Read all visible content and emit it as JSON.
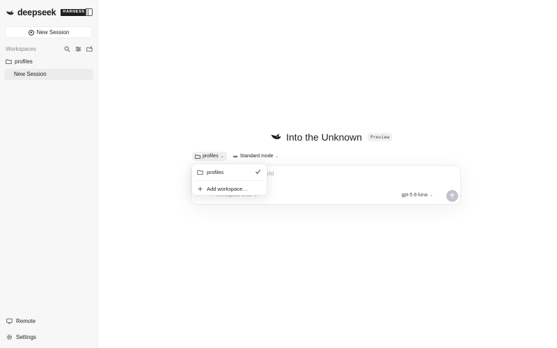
{
  "sidebar": {
    "brand": "deepseek",
    "badge": "HARNESS",
    "new_session": "New Session",
    "workspaces_label": "Workspaces",
    "workspace_name": "profiles",
    "session_name": "New Session",
    "footer": {
      "remote": "Remote",
      "settings": "Settings"
    }
  },
  "main": {
    "title": "Into the Unknown",
    "badge": "Preview",
    "workspace_chip": "profiles",
    "mode_chip": "Standard mode",
    "placeholder": "uild",
    "access_label": "Workspace write",
    "model": "gpt-5.6-luna"
  },
  "dropdown": {
    "items": [
      {
        "label": "profiles",
        "selected": true
      },
      {
        "label": "Add workspace…"
      }
    ]
  },
  "colors": {
    "sidebar_bg": "#f7f7f8",
    "send_button": "#c2c3cc",
    "active_item": "#ececee"
  }
}
